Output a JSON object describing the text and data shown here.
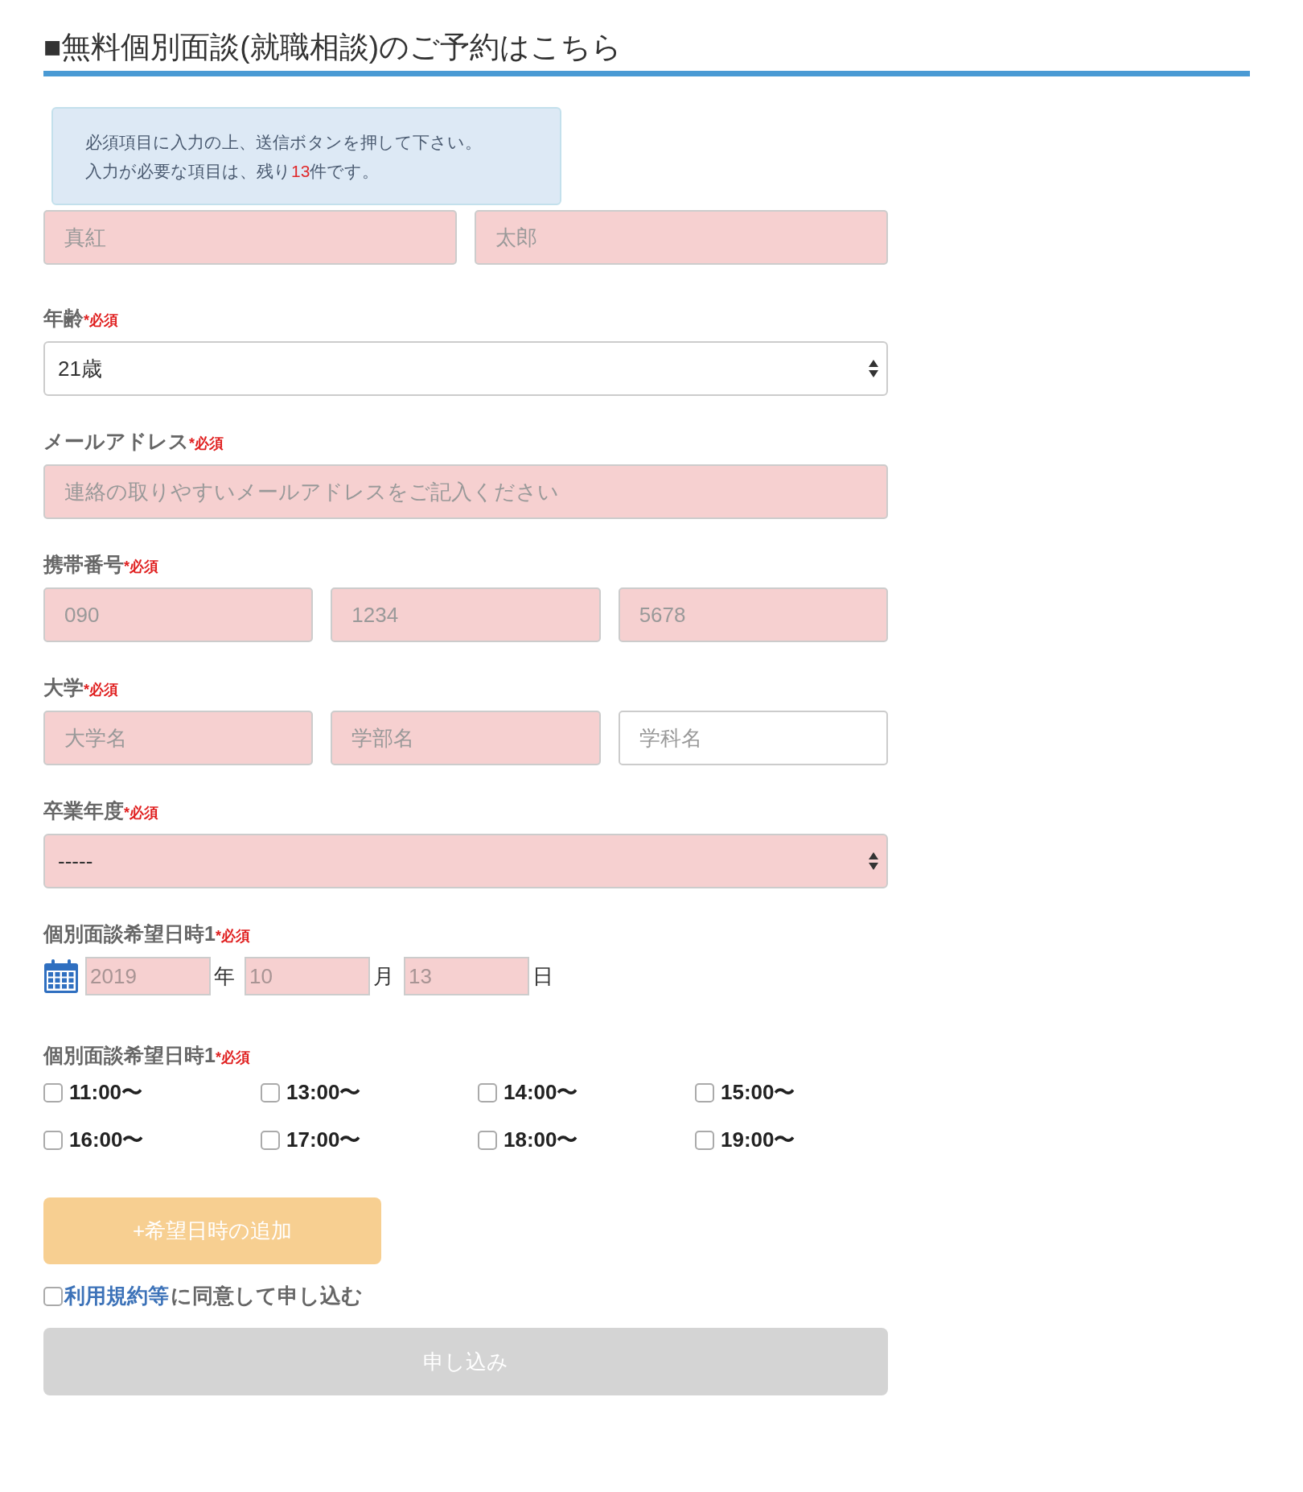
{
  "heading": "■無料個別面談(就職相談)のご予約はこちら",
  "notice": {
    "line1": "必須項目に入力の上、送信ボタンを押して下さい。",
    "line2_before": "入力が必要な項目は、残り",
    "count": "13",
    "line2_after": "件です。"
  },
  "groups": [
    {
      "kind": "text-row",
      "inputs": [
        {
          "placeholder": "真紅",
          "invalid": true
        },
        {
          "placeholder": "太郎",
          "invalid": true
        }
      ]
    },
    {
      "kind": "select",
      "label": "年齢",
      "required_mark": "*必須",
      "value": "21歳",
      "invalid": false
    },
    {
      "kind": "text-row",
      "label": "メールアドレス",
      "required_mark": "*必須",
      "inputs": [
        {
          "placeholder": "連絡の取りやすいメールアドレスをご記入ください",
          "invalid": true
        }
      ]
    },
    {
      "kind": "text-row",
      "label": "携帯番号",
      "required_mark": "*必須",
      "inputs": [
        {
          "placeholder": "090",
          "invalid": true
        },
        {
          "placeholder": "1234",
          "invalid": true
        },
        {
          "placeholder": "5678",
          "invalid": true
        }
      ]
    },
    {
      "kind": "text-row",
      "label": "大学",
      "required_mark": "*必須",
      "inputs": [
        {
          "placeholder": "大学名",
          "invalid": true
        },
        {
          "placeholder": "学部名",
          "invalid": true
        },
        {
          "placeholder": "学科名",
          "invalid": false
        }
      ]
    },
    {
      "kind": "select",
      "label": "卒業年度",
      "required_mark": "*必須",
      "value": "-----",
      "invalid": true
    },
    {
      "kind": "date",
      "label": "個別面談希望日時1",
      "required_mark": "*必須",
      "parts": [
        {
          "placeholder": "2019",
          "unit": "年",
          "invalid": true
        },
        {
          "placeholder": "10",
          "unit": "月",
          "invalid": true
        },
        {
          "placeholder": "13",
          "unit": "日",
          "invalid": true
        }
      ]
    },
    {
      "kind": "checkboxes",
      "label": "個別面談希望日時1",
      "required_mark": "*必須",
      "options": [
        {
          "label": "11:00〜",
          "checked": false
        },
        {
          "label": "13:00〜",
          "checked": false
        },
        {
          "label": "14:00〜",
          "checked": false
        },
        {
          "label": "15:00〜",
          "checked": false
        },
        {
          "label": "16:00〜",
          "checked": false
        },
        {
          "label": "17:00〜",
          "checked": false
        },
        {
          "label": "18:00〜",
          "checked": false
        },
        {
          "label": "19:00〜",
          "checked": false
        }
      ]
    }
  ],
  "add_button": "+希望日時の追加",
  "agreement": {
    "link": "利用規約等",
    "text": "に同意して申し込む",
    "checked": false
  },
  "submit": {
    "label": "申し込み",
    "disabled": true
  }
}
